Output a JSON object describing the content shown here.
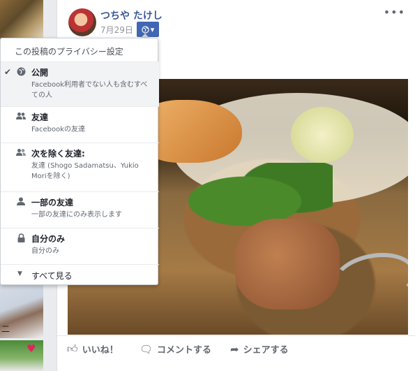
{
  "post": {
    "author": "つちや たけし",
    "date": "7月29日",
    "more_icon": "•••"
  },
  "sidebar": {
    "partial_label": "二"
  },
  "privacy_menu": {
    "title": "この投稿のプライバシー設定",
    "options": [
      {
        "label": "公開",
        "desc": "Facebook利用者でない人も含むすべての人",
        "icon": "globe-icon",
        "selected": true
      },
      {
        "label": "友達",
        "desc": "Facebookの友達",
        "icon": "friends-icon",
        "selected": false
      },
      {
        "label": "次を除く友達:",
        "desc": "友達 (Shogo Sadamatsu、Yukio Moriを除く)",
        "icon": "friends-except-icon",
        "selected": false
      },
      {
        "label": "一部の友達",
        "desc": "一部の友達にのみ表示します",
        "icon": "person-icon",
        "selected": false
      },
      {
        "label": "自分のみ",
        "desc": "自分のみ",
        "icon": "lock-icon",
        "selected": false
      }
    ],
    "see_all": "すべて見る"
  },
  "actions": {
    "like": "いいね！",
    "comment": "コメントする",
    "share": "シェアする"
  },
  "colors": {
    "accent": "#4267b2",
    "link": "#385898",
    "background": "#e9ebee"
  }
}
